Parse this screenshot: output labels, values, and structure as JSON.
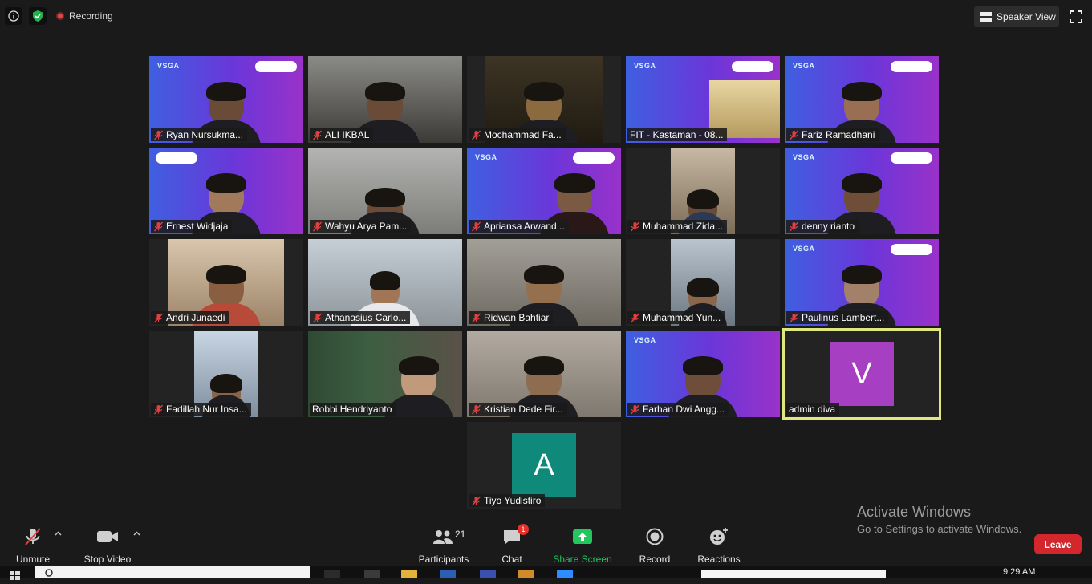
{
  "top_bar": {
    "info_icon": "info-icon",
    "shield_icon": "shield-check-icon",
    "recording_label": "Recording",
    "view_label": "Speaker View",
    "fullscreen_icon": "fullscreen-icon"
  },
  "participants": [
    {
      "name": "Ryan Nursukma...",
      "muted": true
    },
    {
      "name": "ALI IKBAL",
      "muted": true
    },
    {
      "name": "Mochammad Fa...",
      "muted": true
    },
    {
      "name": "FIT -  Kastaman - 08...",
      "muted": false
    },
    {
      "name": "Fariz Ramadhani",
      "muted": true
    },
    {
      "name": "Ernest Widjaja",
      "muted": true
    },
    {
      "name": "Wahyu Arya Pam...",
      "muted": true
    },
    {
      "name": "Apriansa Arwand...",
      "muted": true
    },
    {
      "name": "Muhammad Zida...",
      "muted": true
    },
    {
      "name": "denny rianto",
      "muted": true
    },
    {
      "name": "Andri Junaedi",
      "muted": true
    },
    {
      "name": "Athanasius Carlo...",
      "muted": true
    },
    {
      "name": "Ridwan Bahtiar",
      "muted": true
    },
    {
      "name": "Muhammad Yun...",
      "muted": true
    },
    {
      "name": "Paulinus Lambert...",
      "muted": true
    },
    {
      "name": "Fadillah Nur Insa...",
      "muted": true
    },
    {
      "name": "Robbi Hendriyanto",
      "muted": false
    },
    {
      "name": "Kristian Dede Fir...",
      "muted": true
    },
    {
      "name": "Farhan Dwi Angg...",
      "muted": true
    },
    {
      "name": "admin diva",
      "muted": false,
      "avatar_letter": "V",
      "avatar_color": "#a63fc2",
      "active_speaker": true
    },
    {
      "name": "Tiyo Yudistiro",
      "muted": true,
      "avatar_letter": "A",
      "avatar_color": "#0f8a7a"
    }
  ],
  "vsga_brand": "VSGA",
  "controls": {
    "unmute": "Unmute",
    "stop_video": "Stop Video",
    "participants": "Participants",
    "participants_count": "21",
    "chat": "Chat",
    "chat_badge": "1",
    "share_screen": "Share Screen",
    "record": "Record",
    "reactions": "Reactions",
    "leave": "Leave",
    "share_color": "#22c55e",
    "leave_color": "#d4272d"
  },
  "watermark": {
    "title": "Activate Windows",
    "subtitle": "Go to Settings to activate Windows."
  },
  "taskbar": {
    "clock": "9:29 AM"
  }
}
